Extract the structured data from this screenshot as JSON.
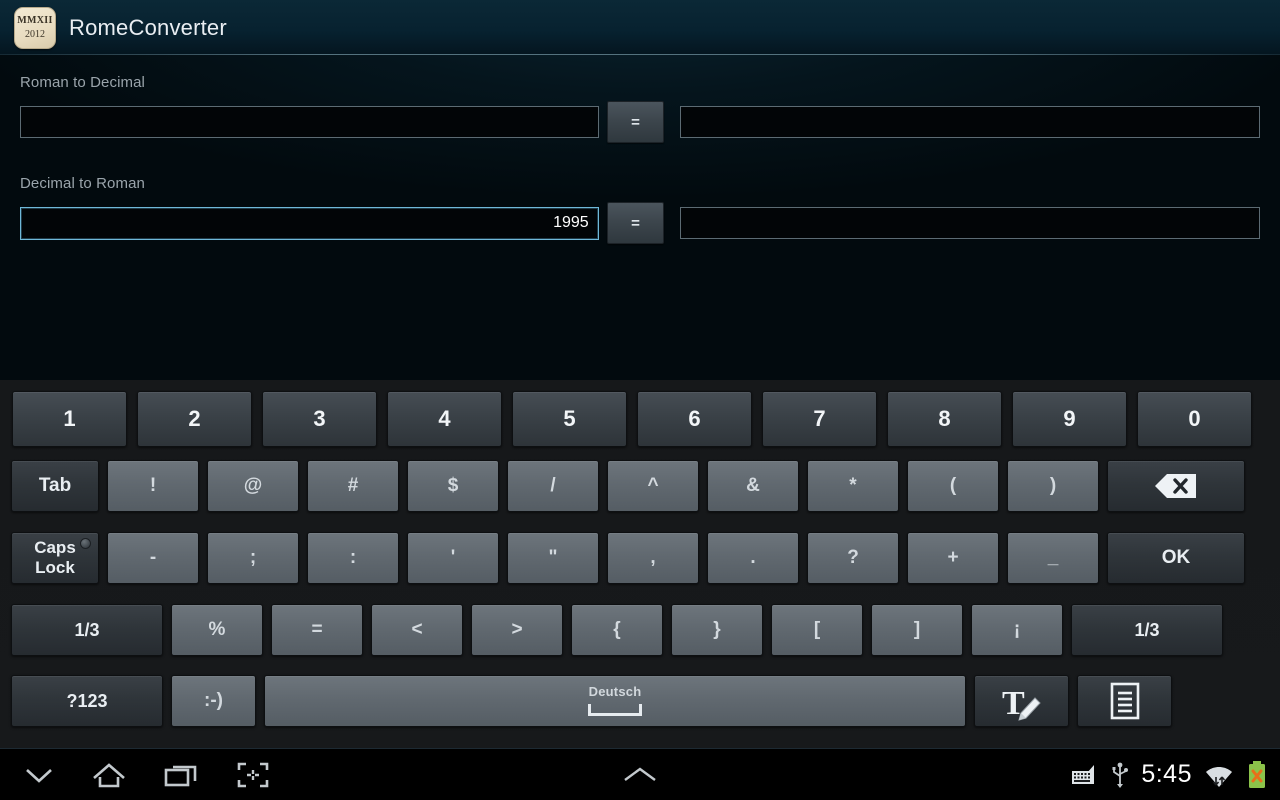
{
  "app": {
    "title": "RomeConverter",
    "icon": {
      "name": "app-icon-mmxii",
      "line1": "MMXII",
      "line2": "2012"
    }
  },
  "form": {
    "roman_to_decimal": {
      "label": "Roman to Decimal",
      "input_value": "",
      "equals_label": "=",
      "output_value": ""
    },
    "decimal_to_roman": {
      "label": "Decimal to Roman",
      "input_value": "1995",
      "equals_label": "=",
      "output_value": ""
    }
  },
  "keyboard": {
    "language": "Deutsch",
    "rows": {
      "numbers": [
        "1",
        "2",
        "3",
        "4",
        "5",
        "6",
        "7",
        "8",
        "9",
        "0"
      ],
      "row2_left": "Tab",
      "row2_symbols": [
        "!",
        "@",
        "#",
        "$",
        "/",
        "^",
        "&",
        "*",
        "(",
        ")"
      ],
      "row2_right": "backspace-icon",
      "row3_left_line1": "Caps",
      "row3_left_line2": "Lock",
      "row3_symbols": [
        "-",
        ";",
        ":",
        "'",
        "\"",
        ",",
        ".",
        "?",
        "+",
        "_"
      ],
      "row3_right": "OK",
      "row4_left": "1/3",
      "row4_symbols": [
        "%",
        "=",
        "<",
        ">",
        "{",
        "}",
        "[",
        "]",
        "¡"
      ],
      "row4_right": "1/3",
      "row5_left": "?123",
      "row5_emoji": ":-)",
      "row5_handwriting": "handwriting-icon",
      "row5_clipboard": "clipboard-icon"
    }
  },
  "system_bar": {
    "back_icon": "chevron-down-icon",
    "home_icon": "home-icon",
    "recents_icon": "recents-icon",
    "screenshot_icon": "screenshot-icon",
    "expand_icon": "chevron-up-icon",
    "keyboard_icon": "keyboard-icon",
    "usb_icon": "usb-icon",
    "time": "5:45",
    "wifi_icon": "wifi-icon",
    "battery_icon": "battery-error-icon"
  },
  "colors": {
    "accent_focus": "#6fb8d8",
    "title_bar": "#0b2836",
    "key_light": "#616970",
    "key_dark": "#2f353a",
    "battery_green": "#8bc34a"
  }
}
